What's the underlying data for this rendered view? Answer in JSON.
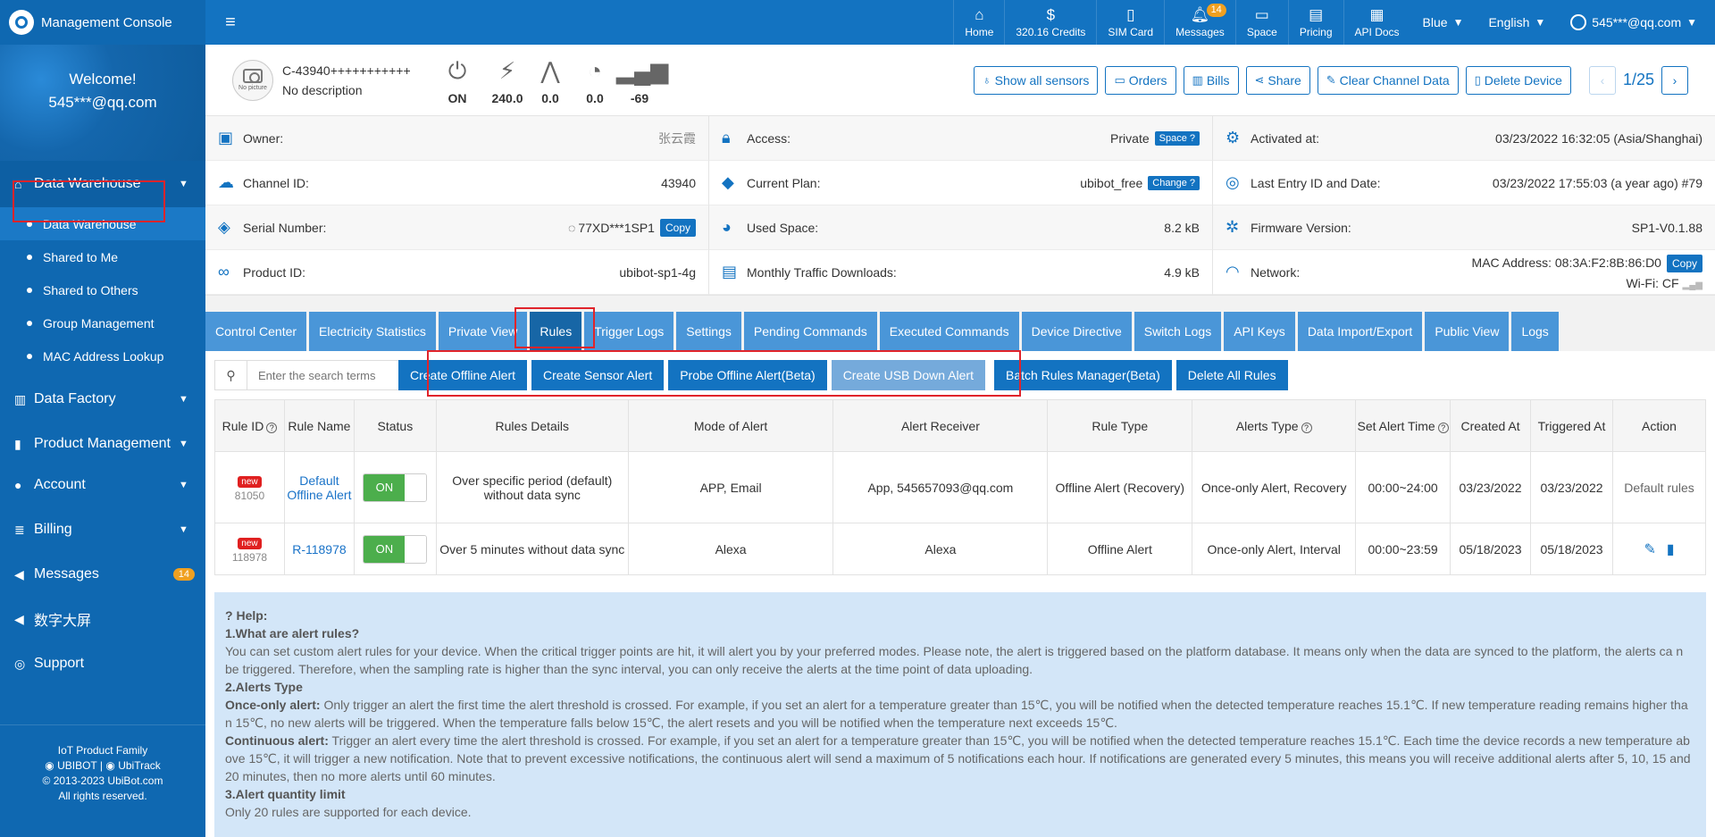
{
  "app": {
    "title": "Management Console"
  },
  "topnav": {
    "items": [
      {
        "icon": "home-icon",
        "label": "Home"
      },
      {
        "icon": "credits-icon",
        "label": "320.16 Credits"
      },
      {
        "icon": "sim-card-icon",
        "label": "SIM Card"
      },
      {
        "icon": "messages-icon",
        "label": "Messages",
        "badge": "14"
      },
      {
        "icon": "space-icon",
        "label": "Space"
      },
      {
        "icon": "pricing-icon",
        "label": "Pricing"
      },
      {
        "icon": "api-docs-icon",
        "label": "API Docs"
      }
    ],
    "theme": "Blue",
    "language": "English",
    "user": "545***@qq.com"
  },
  "sidebar": {
    "welcome_line1": "Welcome!",
    "welcome_line2": "545***@qq.com",
    "groups": [
      {
        "label": "Data Warehouse"
      },
      {
        "label": "Data Factory"
      },
      {
        "label": "Product Management"
      },
      {
        "label": "Account"
      },
      {
        "label": "Billing"
      },
      {
        "label": "Messages",
        "badge": "14"
      },
      {
        "label": "数字大屏"
      },
      {
        "label": "Support"
      }
    ],
    "subitems": [
      "Data Warehouse",
      "Shared to Me",
      "Shared to Others",
      "Group Management",
      "MAC Address Lookup"
    ],
    "footer": {
      "line1": "IoT Product Family",
      "brand1": "UBIBOT",
      "sep": "|",
      "brand2": "UbiTrack",
      "copyright": "© 2013-2023 UbiBot.com",
      "rights": "All rights reserved."
    }
  },
  "device": {
    "picture_text": "No picture",
    "name": "C-43940+++++++++++",
    "description": "No description",
    "metrics": [
      {
        "icon": "power-icon",
        "value": "ON"
      },
      {
        "icon": "lightning-icon",
        "value": "240.0"
      },
      {
        "icon": "antenna-icon",
        "value": "0.0"
      },
      {
        "icon": "gauge-icon",
        "value": "0.0"
      },
      {
        "icon": "signal-icon",
        "value": "-69"
      }
    ],
    "actions": [
      "Show all sensors",
      "Orders",
      "Bills",
      "Share",
      "Clear Channel Data",
      "Delete Device"
    ],
    "pager": "1/25"
  },
  "info": {
    "owner_label": "Owner:",
    "owner_value": "张云霞",
    "access_label": "Access:",
    "access_value": "Private",
    "access_tag": "Space ?",
    "activated_label": "Activated at:",
    "activated_value": "03/23/2022 16:32:05 (Asia/Shanghai)",
    "channel_label": "Channel ID:",
    "channel_value": "43940",
    "plan_label": "Current Plan:",
    "plan_value": "ubibot_free",
    "plan_tag": "Change ?",
    "last_entry_label": "Last Entry ID and Date:",
    "last_entry_value": "03/23/2022 17:55:03 (a year ago) #79",
    "serial_label": "Serial Number:",
    "serial_value": "77XD***1SP1",
    "copy_label": "Copy",
    "used_space_label": "Used Space:",
    "used_space_value": "8.2 kB",
    "firmware_label": "Firmware Version:",
    "firmware_value": "SP1-V0.1.88",
    "product_label": "Product ID:",
    "product_value": "ubibot-sp1-4g",
    "traffic_label": "Monthly Traffic Downloads:",
    "traffic_value": "4.9 kB",
    "network_label": "Network:",
    "mac_value": "MAC Address: 08:3A:F2:8B:86:D0",
    "wifi_value": "Wi-Fi: CF"
  },
  "tabs": [
    "Control Center",
    "Electricity Statistics",
    "Private View",
    "Rules",
    "Trigger Logs",
    "Settings",
    "Pending Commands",
    "Executed Commands",
    "Device Directive",
    "Switch Logs",
    "API Keys",
    "Data Import/Export",
    "Public View",
    "Logs"
  ],
  "active_tab": "Rules",
  "toolbar": {
    "search_placeholder": "Enter the search terms",
    "buttons": [
      "Create Offline Alert",
      "Create Sensor Alert",
      "Probe Offline Alert(Beta)",
      "Create USB Down Alert",
      "Batch Rules Manager(Beta)",
      "Delete All Rules"
    ]
  },
  "table": {
    "headers": [
      "Rule ID",
      "Rule Name",
      "Status",
      "Rules Details",
      "Mode of Alert",
      "Alert Receiver",
      "Rule Type",
      "Alerts Type",
      "Set Alert Time",
      "Created At",
      "Triggered At",
      "Action"
    ],
    "rows": [
      {
        "badge": "new",
        "id": "81050",
        "name": "Default Offline Alert",
        "status": "ON",
        "details": "Over specific period (default) without data sync",
        "mode": "APP, Email",
        "receiver": "App, 545657093@qq.com",
        "type": "Offline Alert (Recovery)",
        "alerts_type": "Once-only Alert, Recovery",
        "time": "00:00~24:00",
        "created": "03/23/2022",
        "triggered": "03/23/2022",
        "action": "Default rules"
      },
      {
        "badge": "new",
        "id": "118978",
        "name": "R-118978",
        "status": "ON",
        "details": "Over 5 minutes without data sync",
        "mode": "Alexa",
        "receiver": "Alexa",
        "type": "Offline Alert",
        "alerts_type": "Once-only Alert, Interval",
        "time": "00:00~23:59",
        "created": "05/18/2023",
        "triggered": "05/18/2023",
        "action": ""
      }
    ]
  },
  "help": {
    "title": "Help:",
    "q1": "1.What are alert rules?",
    "a1": "You can set custom alert rules for your device. When the critical trigger points are hit, it will alert you by your preferred modes. Please note, the alert is triggered based on the platform database. It means only when the data are synced to the platform, the alerts ca n be triggered. Therefore, when the sampling rate is higher than the sync interval, you can only receive the alerts at the time point of data uploading.",
    "q2": "2.Alerts Type",
    "once_label": "Once-only alert:",
    "once_text": "Only trigger an alert the first time the alert threshold is crossed. For example, if you set an alert for a temperature greater than 15℃, you will be notified when the detected temperature reaches 15.1℃. If new temperature reading remains higher tha n 15℃, no new alerts will be triggered. When the temperature falls below 15℃, the alert resets and you will be notified when the temperature next exceeds 15℃.",
    "cont_label": "Continuous alert:",
    "cont_text": "Trigger an alert every time the alert threshold is crossed. For example, if you set an alert for a temperature greater than 15℃, you will be notified when the detected temperature reaches 15.1℃. Each time the device records a new temperature ab ove 15℃, it will trigger a new notification. Note that to prevent excessive notifications, the continuous alert will send a maximum of 5 notifications each hour. If notifications are generated every 5 minutes, this means you will receive additional alerts after 5, 10, 15 and 20 minutes, then no more alerts until 60 minutes.",
    "q3": "3.Alert quantity limit",
    "a3": "Only 20 rules are supported for each device."
  },
  "colors": {
    "primary": "#1373c1",
    "sidebar": "#0f68b1",
    "tab": "#4a96d8",
    "tab_active": "#1766a6",
    "help_bg": "#d3e6f8",
    "highlight": "#e0242b",
    "toggle_on": "#4cae4c",
    "badge": "#f0a020"
  }
}
